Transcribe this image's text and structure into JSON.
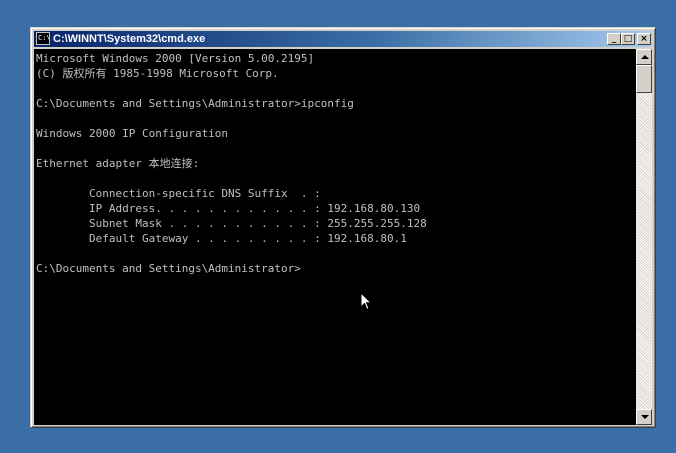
{
  "window": {
    "title": "C:\\WINNT\\System32\\cmd.exe",
    "icon_label": "C:\\",
    "minimize_glyph": "_",
    "maximize_glyph": "□",
    "close_glyph": "×"
  },
  "console": {
    "lines": [
      "Microsoft Windows 2000 [Version 5.00.2195]",
      "(C) 版权所有 1985-1998 Microsoft Corp.",
      "",
      "C:\\Documents and Settings\\Administrator>ipconfig",
      "",
      "Windows 2000 IP Configuration",
      "",
      "Ethernet adapter 本地连接:",
      "",
      "        Connection-specific DNS Suffix  . :",
      "        IP Address. . . . . . . . . . . . : 192.168.80.130",
      "        Subnet Mask . . . . . . . . . . . : 255.255.255.128",
      "        Default Gateway . . . . . . . . . : 192.168.80.1",
      "",
      "C:\\Documents and Settings\\Administrator>"
    ]
  },
  "colors": {
    "desktop": "#3a6ea5",
    "console_bg": "#000000",
    "console_text": "#c0c0c0",
    "titlebar_start": "#0a246a",
    "titlebar_end": "#a6caf0"
  },
  "icons": {
    "window_icon": "cmd-icon",
    "mouse": "arrow-cursor-icon"
  }
}
